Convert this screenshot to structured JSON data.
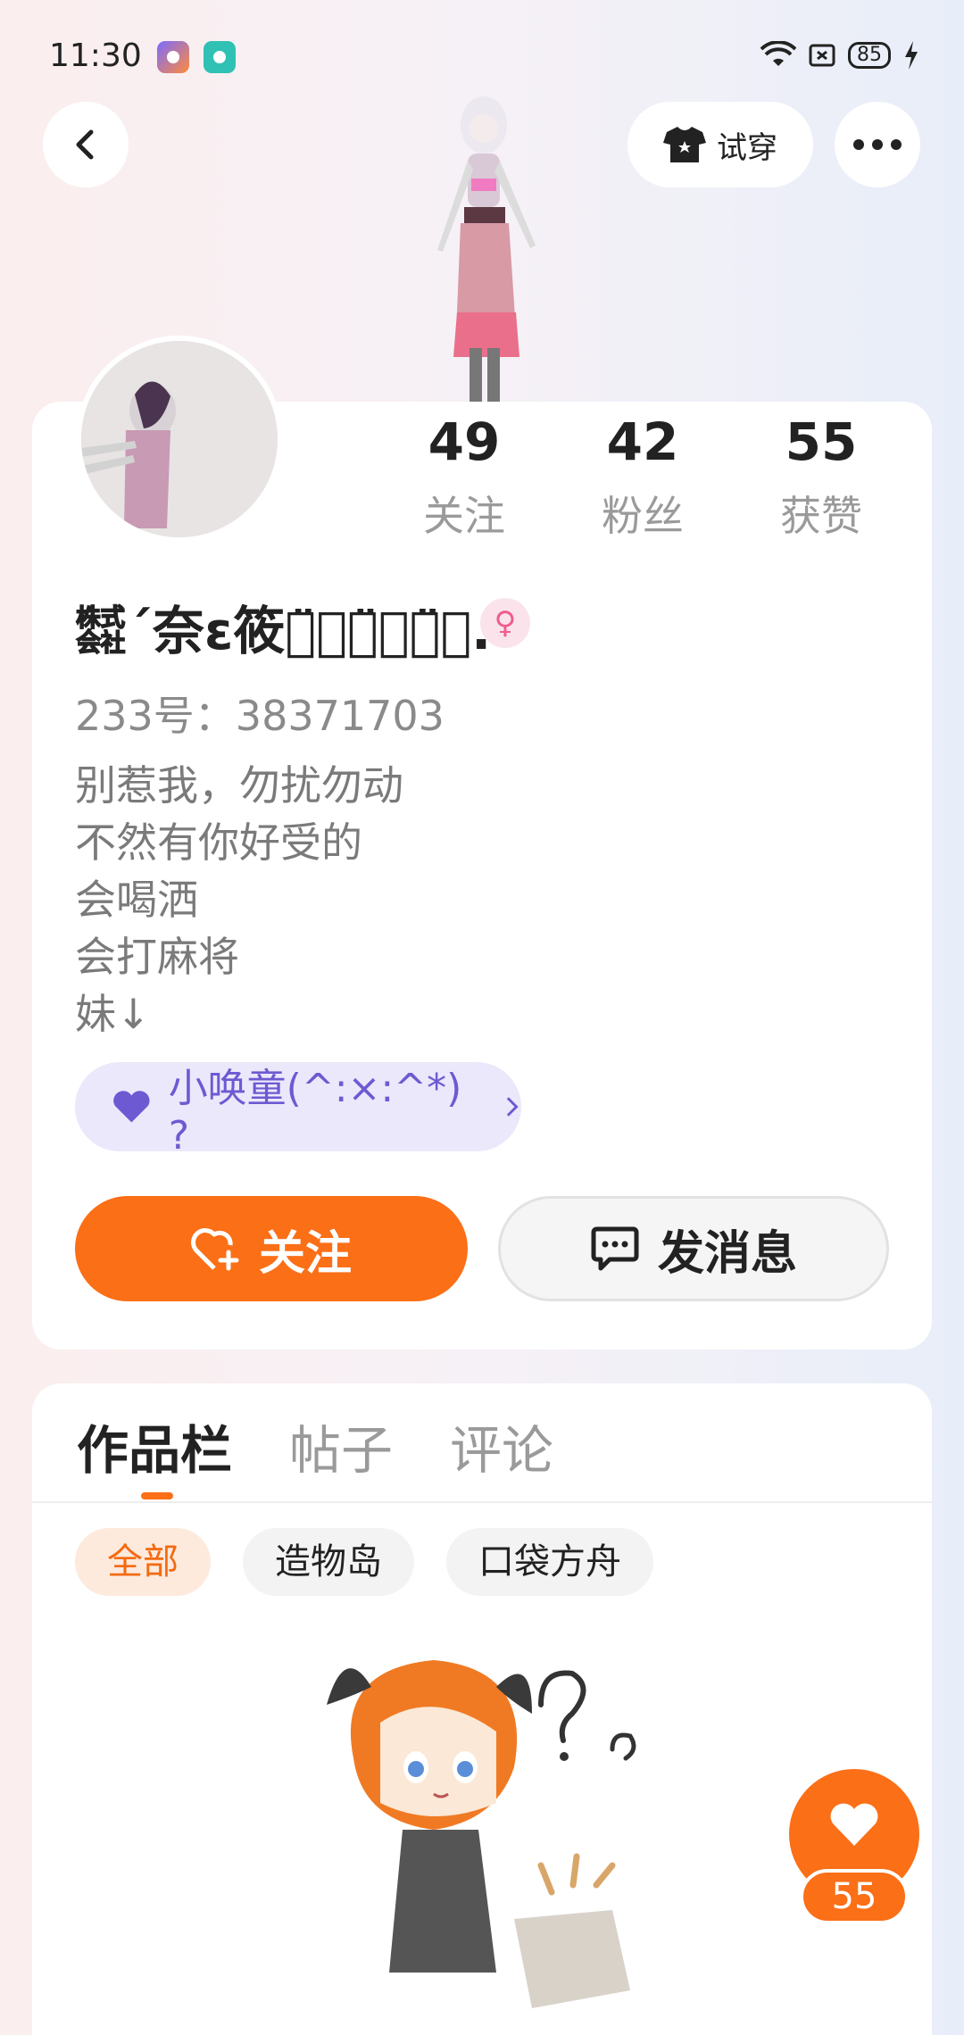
{
  "status_bar": {
    "time": "11:30",
    "battery": "85",
    "icons": [
      "app-icon-1",
      "app-icon-2",
      "wifi-icon",
      "sim-icon",
      "battery-icon",
      "charging-icon"
    ]
  },
  "top_bar": {
    "try_on_label": "试穿",
    "icons": [
      "back-icon",
      "shirt-icon",
      "more-icon"
    ]
  },
  "profile": {
    "stats": [
      {
        "value": "49",
        "label": "关注"
      },
      {
        "value": "42",
        "label": "粉丝"
      },
      {
        "value": "55",
        "label": "获赞"
      }
    ],
    "nickname": "㍿´奈ε筱ㄅ̈⃝ㄧ̈⃝ㄔ̈⃝.",
    "gender_icon": "female-icon",
    "uid": "233号：38371703",
    "bio_lines": [
      "别惹我，勿扰勿动",
      "不然有你好受的",
      "会喝洒",
      "会打麻将",
      "妹↓"
    ],
    "summon_chip": "小唤童(^:×:^*) ?",
    "follow_label": "关注",
    "message_label": "发消息"
  },
  "works": {
    "tabs": [
      "作品栏",
      "帖子",
      "评论"
    ],
    "active_tab": "作品栏",
    "filters": [
      "全部",
      "造物岛",
      "口袋方舟"
    ],
    "active_filter": "全部"
  },
  "like_button": {
    "count": "55"
  },
  "colors": {
    "accent": "#fb6f17",
    "summon_bg": "#ebe8fb",
    "summon_text": "#6d5ad2"
  }
}
